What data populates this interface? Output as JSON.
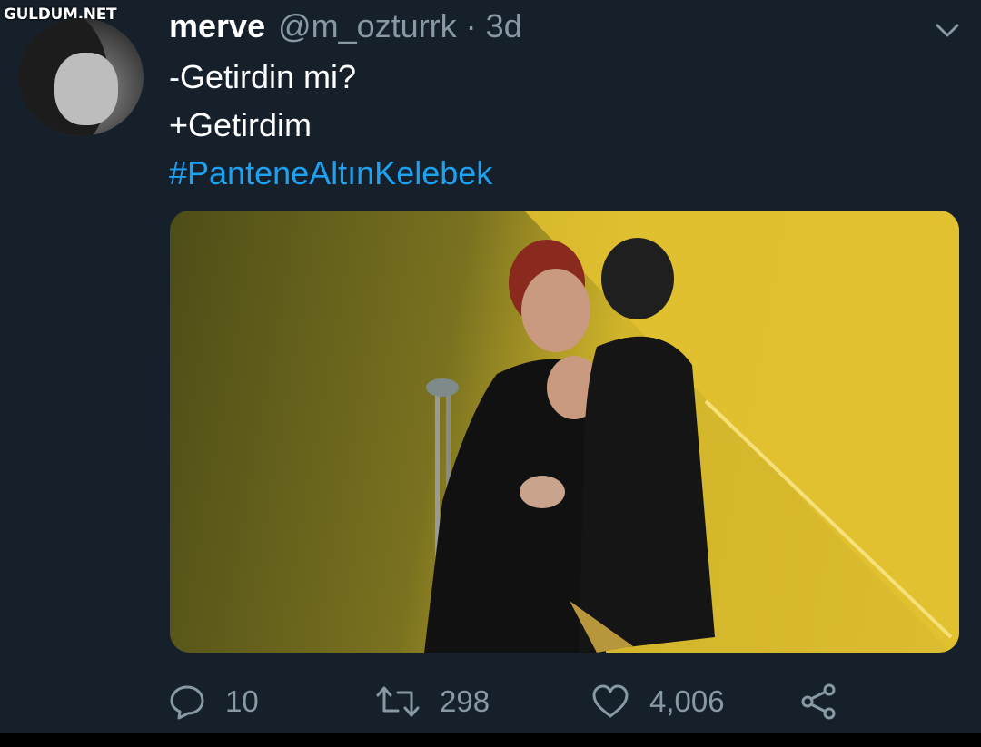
{
  "watermark": "GULDUM.NET",
  "tweet": {
    "author_name": "merve",
    "author_handle": "@m_ozturrk",
    "separator": "·",
    "time_ago": "3d",
    "lines": [
      "-Getirdin mi?",
      "+Getirdim"
    ],
    "hashtag": "#PanteneAltınKelebek"
  },
  "actions": {
    "replies": "10",
    "retweets": "298",
    "likes": "4,006"
  },
  "colors": {
    "background": "#15202b",
    "text": "#ffffff",
    "secondary": "#8899a6",
    "link": "#1da1f2"
  },
  "icons": [
    "avatar",
    "chevron-down-icon",
    "reply-icon",
    "retweet-icon",
    "like-icon",
    "share-icon"
  ]
}
